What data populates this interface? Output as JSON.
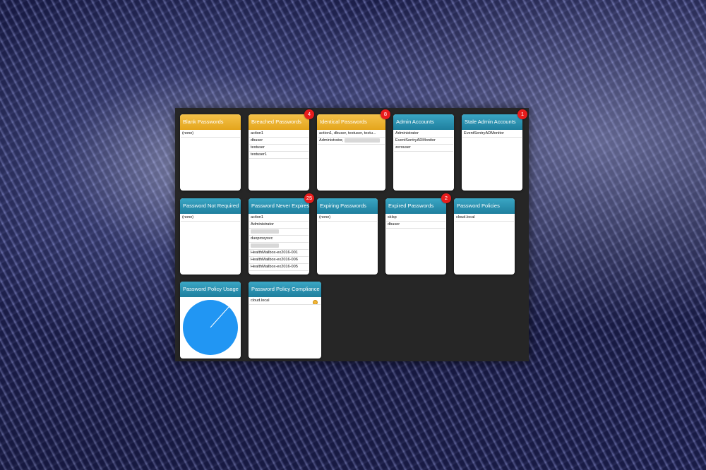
{
  "cards": {
    "blank_passwords": {
      "title": "Blank Passwords",
      "rows": [
        "(none)"
      ]
    },
    "breached_passwords": {
      "title": "Breached Passwords",
      "badge": "4",
      "rows": [
        "action1",
        "dbuser",
        "testuser",
        "testuser1"
      ]
    },
    "identical_passwords": {
      "title": "Identical Passwords",
      "badge": "8",
      "rows": [
        "action1, dbuser, testuser, testu...",
        "Administrator,"
      ]
    },
    "admin_accounts": {
      "title": "Admin Accounts",
      "rows": [
        "Administrator",
        "EventSentryADMonitor",
        "zerouser"
      ]
    },
    "stale_admin_accounts": {
      "title": "Stale Admin Accounts",
      "badge": "1",
      "rows": [
        "EventSentryADMonitor"
      ]
    },
    "password_not_required": {
      "title": "Password Not Required",
      "rows": [
        "(none)"
      ]
    },
    "password_never_expires": {
      "title": "Password Never Expires",
      "badge": "25",
      "rows": [
        "action1",
        "Administrator",
        "duoproxysvc",
        "HealthMailbox-ex2016-001",
        "HealthMailbox-ex2016-006",
        "HealthMailbox-ex2016-005"
      ]
    },
    "expiring_passwords": {
      "title": "Expiring Passwords",
      "rows": [
        "(none)"
      ]
    },
    "expired_passwords": {
      "title": "Expired Passwords",
      "badge": "2",
      "rows": [
        "sklsp",
        "dbuser"
      ]
    },
    "password_policies": {
      "title": "Password Policies",
      "rows": [
        "cloud.local"
      ]
    },
    "password_policy_usage": {
      "title": "Password Policy Usage",
      "pie_color": "#2196f3",
      "pie_fraction": 1.0
    },
    "password_policy_compliance": {
      "title": "Password Policy Compliance",
      "rows": [
        "cloud.local"
      ],
      "status_color": "#f1b434"
    }
  },
  "colors": {
    "header_yellow": "#e4a51c",
    "header_teal": "#1f7f9e",
    "badge_red": "#e81c1c",
    "panel_bg": "#262626"
  }
}
